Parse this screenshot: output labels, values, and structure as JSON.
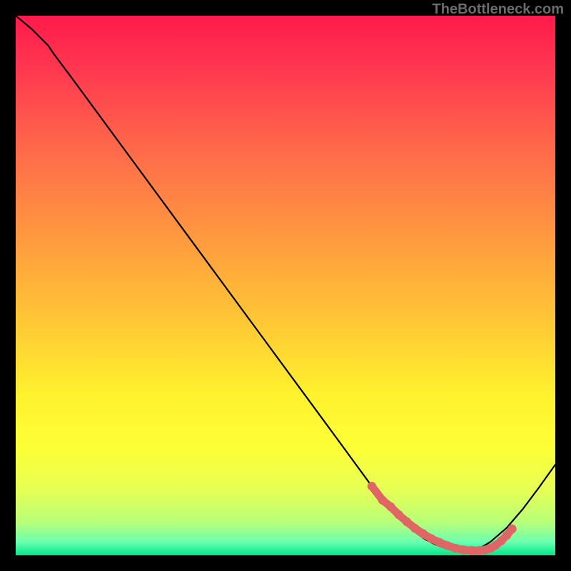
{
  "watermark": "TheBottleneck.com",
  "colors": {
    "curve": "#000000",
    "marker": "#e06666",
    "background_border": "#000000"
  },
  "gradient_stops": [
    {
      "offset": 0.0,
      "color": "#ff1a4b"
    },
    {
      "offset": 0.1,
      "color": "#ff3850"
    },
    {
      "offset": 0.25,
      "color": "#ff6a4a"
    },
    {
      "offset": 0.4,
      "color": "#ff9640"
    },
    {
      "offset": 0.55,
      "color": "#ffc236"
    },
    {
      "offset": 0.7,
      "color": "#fff12e"
    },
    {
      "offset": 0.8,
      "color": "#fdff36"
    },
    {
      "offset": 0.88,
      "color": "#e6ff55"
    },
    {
      "offset": 0.94,
      "color": "#b6ff7a"
    },
    {
      "offset": 0.975,
      "color": "#6cffb0"
    },
    {
      "offset": 1.0,
      "color": "#00e88c"
    }
  ],
  "chart_data": {
    "type": "line",
    "title": "",
    "xlabel": "",
    "ylabel": "",
    "xlim": [
      0,
      100
    ],
    "ylim": [
      0,
      100
    ],
    "series": [
      {
        "name": "bottleneck_curve",
        "x": [
          0,
          3,
          6,
          7,
          10,
          15,
          20,
          25,
          30,
          35,
          40,
          45,
          50,
          55,
          60,
          63,
          66,
          68,
          70,
          72,
          74,
          76,
          78,
          80,
          82,
          84,
          86,
          88,
          91,
          94,
          97,
          100
        ],
        "y": [
          100,
          97.5,
          94.5,
          93,
          89,
          82.2,
          75.4,
          68.6,
          61.8,
          55,
          48.2,
          41.4,
          34.6,
          27.8,
          21,
          16.9,
          12.8,
          10.2,
          8,
          6,
          4.3,
          2.9,
          1.9,
          1.2,
          0.8,
          0.8,
          1.3,
          2.5,
          5.1,
          8.6,
          12.6,
          16.8
        ]
      },
      {
        "name": "sweet_spot_band",
        "x": [
          66,
          68,
          69.5,
          71,
          72.5,
          74,
          75.5,
          77,
          78.5,
          80,
          81.5,
          83,
          84.5,
          86,
          87,
          88,
          89,
          90,
          91,
          92
        ],
        "y": [
          12.8,
          10.2,
          9.0,
          7.5,
          6.2,
          5.0,
          4.0,
          3.1,
          2.4,
          1.8,
          1.3,
          1.0,
          0.9,
          0.9,
          1.0,
          1.3,
          1.9,
          2.7,
          3.7,
          4.9
        ]
      }
    ]
  }
}
